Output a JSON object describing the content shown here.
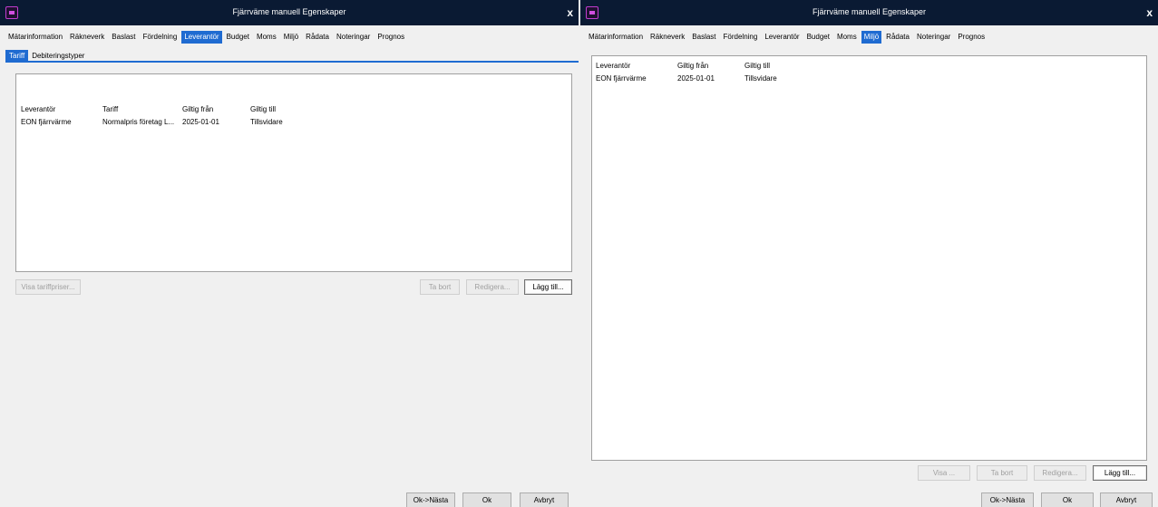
{
  "windows": [
    {
      "title": "Fjärrväme manuell  Egenskaper",
      "close_label": "x",
      "tabs": [
        "Mätarinformation",
        "Räkneverk",
        "Baslast",
        "Fördelning",
        "Leverantör",
        "Budget",
        "Moms",
        "Miljö",
        "Rådata",
        "Noteringar",
        "Prognos"
      ],
      "active_tab": "Leverantör",
      "subtabs": [
        "Tariff",
        "Debiteringstyper"
      ],
      "active_subtab": "Tariff",
      "columns": [
        "Leverantör",
        "Tariff",
        "Giltig från",
        "Giltig till"
      ],
      "rows": [
        [
          "EON fjärrvärme",
          "Normalpris företag L...",
          "2025-01-01",
          "Tillsvidare"
        ]
      ],
      "buttons": {
        "show_tariff_prices": "Visa tariffpriser...",
        "remove": "Ta bort",
        "edit": "Redigera...",
        "add": "Lägg till...",
        "ok_next": "Ok->Nästa",
        "ok": "Ok",
        "cancel": "Avbryt"
      }
    },
    {
      "title": "Fjärrväme manuell  Egenskaper",
      "close_label": "x",
      "tabs": [
        "Mätarinformation",
        "Räkneverk",
        "Baslast",
        "Fördelning",
        "Leverantör",
        "Budget",
        "Moms",
        "Miljö",
        "Rådata",
        "Noteringar",
        "Prognos"
      ],
      "active_tab": "Miljö",
      "columns": [
        "Leverantör",
        "Giltig från",
        "Giltig till"
      ],
      "rows": [
        [
          "EON fjärrvärme",
          "2025-01-01",
          "Tillsvidare"
        ]
      ],
      "buttons": {
        "show": "Visa ...",
        "remove": "Ta bort",
        "edit": "Redigera...",
        "add": "Lägg till...",
        "ok_next": "Ok->Nästa",
        "ok": "Ok",
        "cancel": "Avbryt"
      }
    }
  ]
}
